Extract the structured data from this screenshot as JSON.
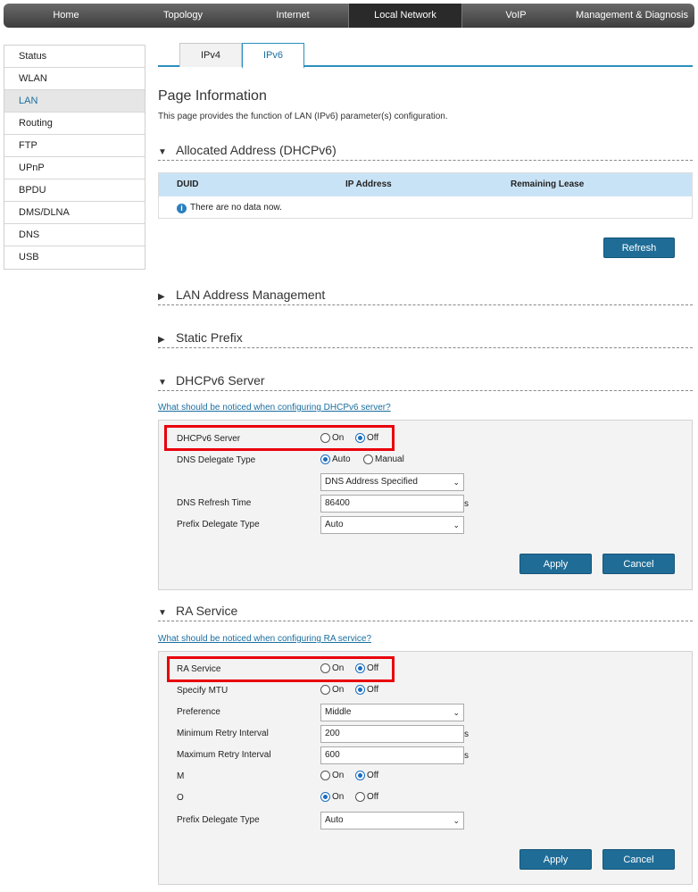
{
  "topnav": [
    "Home",
    "Topology",
    "Internet",
    "Local Network",
    "VoIP",
    "Management & Diagnosis"
  ],
  "sidebar": [
    "Status",
    "WLAN",
    "LAN",
    "Routing",
    "FTP",
    "UPnP",
    "BPDU",
    "DMS/DLNA",
    "DNS",
    "USB"
  ],
  "tabs": [
    "IPv4",
    "IPv6"
  ],
  "page": {
    "title": "Page Information",
    "desc": "This page provides the function of LAN (IPv6) parameter(s) configuration."
  },
  "allocated": {
    "title": "Allocated Address (DHCPv6)",
    "columns": [
      "DUID",
      "IP Address",
      "Remaining Lease"
    ],
    "empty": "There are no data now.",
    "refresh": "Refresh"
  },
  "lan_mgmt": {
    "title": "LAN Address Management"
  },
  "static_prefix": {
    "title": "Static Prefix"
  },
  "dhcpv6": {
    "title": "DHCPv6 Server",
    "link": "What should be noticed when configuring DHCPv6 server?",
    "server_label": "DHCPv6 Server",
    "dns_delegate_label": "DNS Delegate Type",
    "dns_select": "DNS Address Specified",
    "dns_refresh_label": "DNS Refresh Time",
    "dns_refresh_value": "86400",
    "unit": "s",
    "prefix_label": "Prefix Delegate Type",
    "prefix_value": "Auto",
    "on": "On",
    "off": "Off",
    "auto": "Auto",
    "manual": "Manual",
    "apply": "Apply",
    "cancel": "Cancel"
  },
  "ra": {
    "title": "RA Service",
    "link": "What should be noticed when configuring RA service?",
    "service_label": "RA Service",
    "mtu_label": "Specify MTU",
    "pref_label": "Preference",
    "pref_value": "Middle",
    "min_label": "Minimum Retry Interval",
    "min_value": "200",
    "max_label": "Maximum Retry Interval",
    "max_value": "600",
    "unit": "s",
    "m_label": "M",
    "o_label": "O",
    "prefix_label": "Prefix Delegate Type",
    "prefix_value": "Auto",
    "on": "On",
    "off": "Off",
    "apply": "Apply",
    "cancel": "Cancel"
  }
}
